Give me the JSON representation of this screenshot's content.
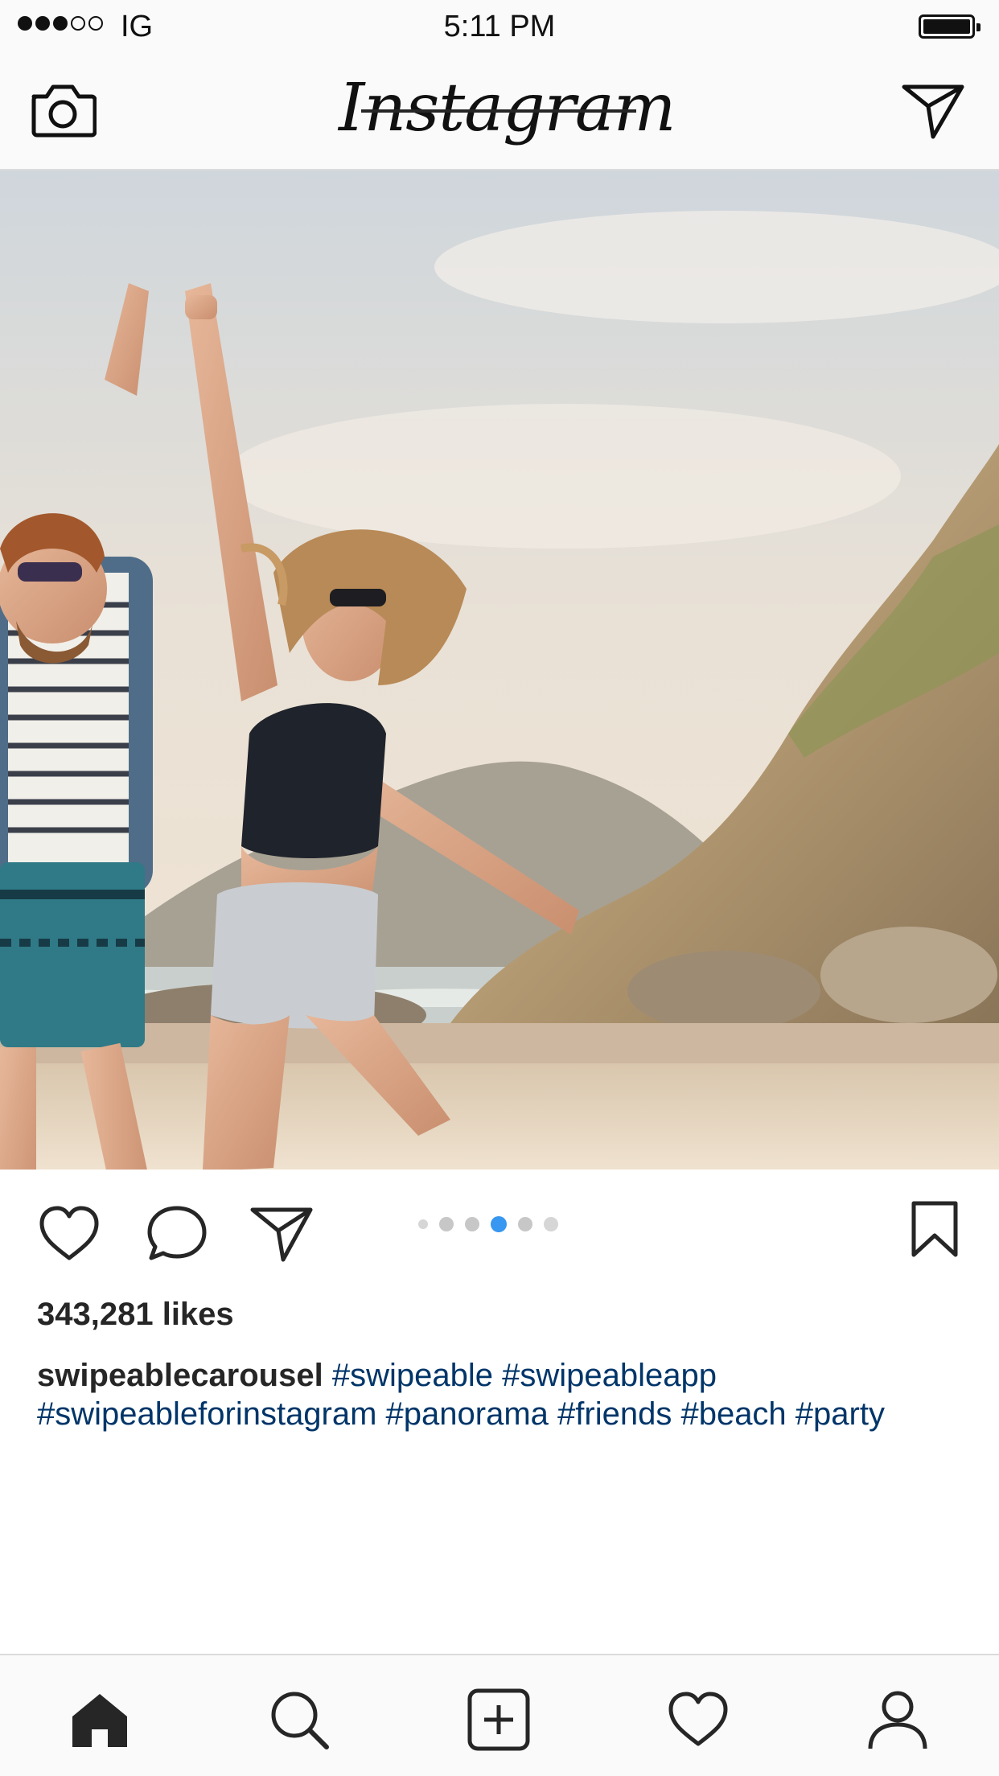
{
  "status_bar": {
    "signal_strength": "3 of 5",
    "carrier": "IG",
    "time": "5:11 PM",
    "battery_level": 1.0
  },
  "header": {
    "logo_text": "Instagram",
    "left_icon": "camera-icon",
    "right_icon": "direct-message-icon"
  },
  "post": {
    "image_description_icon": "photo",
    "actions": {
      "like_icon": "heart-icon",
      "comment_icon": "comment-icon",
      "share_icon": "paper-plane-icon",
      "save_icon": "bookmark-icon"
    },
    "carousel": {
      "total": 6,
      "active_index": 3,
      "active_color": "#3897f0"
    },
    "likes": "343,281 likes",
    "caption": {
      "username": "swipeablecarousel",
      "text": "#swipeable #swipeableapp #swipeableforinstagram #panorama #friends #beach #party"
    }
  },
  "tab_bar": {
    "items": [
      "home-icon",
      "search-icon",
      "add-post-icon",
      "heart-icon",
      "profile-icon"
    ],
    "active": "home-icon"
  },
  "colors": {
    "link": "#003569",
    "accent": "#3897f0",
    "text": "#262626"
  }
}
